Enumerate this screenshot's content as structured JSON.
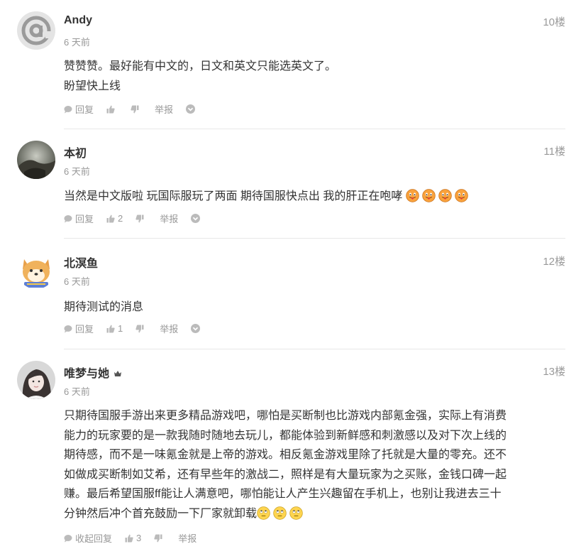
{
  "comments": [
    {
      "user": "Andy",
      "time": "6 天前",
      "floor": "10楼",
      "lines": [
        "赞赞赞。最好能有中文的，日文和英文只能选英文了。",
        "盼望快上线"
      ],
      "reply_label": "回复",
      "like_count": "",
      "report_label": "举报",
      "avatar_icon": "at-sign-avatar"
    },
    {
      "user": "本初",
      "time": "6 天前",
      "floor": "11楼",
      "lines": [
        "当然是中文版啦  玩国际服玩了两面  期待国服快点出  我的肝正在咆哮"
      ],
      "reply_label": "回复",
      "like_count": "2",
      "report_label": "举报",
      "avatar_icon": "landscape-avatar",
      "emoji": "tongue-emoji"
    },
    {
      "user": "北溟鱼",
      "time": "6 天前",
      "floor": "12楼",
      "lines": [
        "期待测试的消息"
      ],
      "reply_label": "回复",
      "like_count": "1",
      "report_label": "举报",
      "avatar_icon": "shiba-dog-avatar"
    },
    {
      "user": "唯梦与她",
      "time": "6 天前",
      "floor": "13楼",
      "lines": [
        "只期待国服手游出来更多精品游戏吧，哪怕是买断制也比游戏内部氪金强，实际上有消费",
        "能力的玩家要的是一款我随时随地去玩儿，都能体验到新鲜感和刺激感以及对下次上线的",
        "期待感，而不是一味氪金就是上帝的游戏。相反氪金游戏里除了托就是大量的零充。还不",
        "如做成买断制如艾希，还有早些年的激战二，照样是有大量玩家为之买账，金钱口碑一起",
        "赚。最后希望国服ff能让人满意吧，哪怕能让人产生兴趣留在手机上，也别让我进去三十",
        "分钟然后冲个首充鼓励一下厂家就卸载"
      ],
      "reply_label": "收起回复",
      "like_count": "3",
      "report_label": "举报",
      "avatar_icon": "girl-photo-avatar",
      "emoji": "rolling-eyes-emoji"
    }
  ]
}
